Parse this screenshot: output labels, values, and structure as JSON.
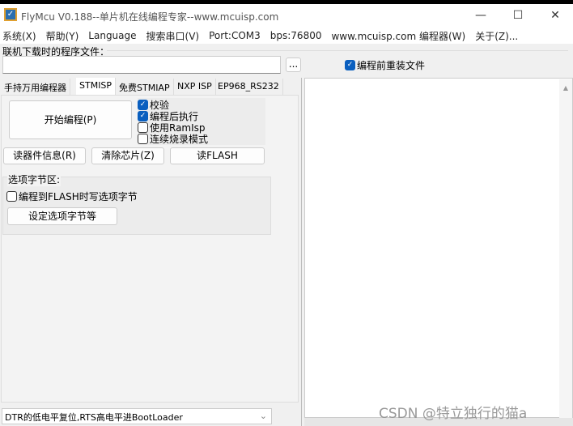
{
  "window": {
    "title": "FlyMcu V0.188--单片机在线编程专家--www.mcuisp.com",
    "minimize": "—",
    "maximize": "☐",
    "close": "✕"
  },
  "menu": [
    "系统(X)",
    "帮助(Y)",
    "Language",
    "搜索串口(V)",
    "Port:COM3",
    "bps:76800",
    "www.mcuisp.com 编程器(W)",
    "关于(Z)..."
  ],
  "file": {
    "label": "联机下载时的程序文件：",
    "value": "",
    "browse": "...",
    "reload_label": "编程前重装文件"
  },
  "tabs": [
    "手持万用编程器",
    "STMISP",
    "免费STMIAP",
    "NXP ISP",
    "EP968_RS232"
  ],
  "stmisp": {
    "start": "开始编程(P)",
    "options": [
      {
        "label": "校验",
        "checked": true
      },
      {
        "label": "编程后执行",
        "checked": true
      },
      {
        "label": "使用RamIsp",
        "checked": false
      },
      {
        "label": "连续烧录模式",
        "checked": false
      }
    ],
    "read_info": "读器件信息(R)",
    "erase": "清除芯片(Z)",
    "read_flash": "读FLASH",
    "option_group": "选项字节区:",
    "write_option": "编程到FLASH时写选项字节",
    "set_option": "设定选项字节等"
  },
  "reset_mode": "DTR的低电平复位,RTS高电平进BootLoader",
  "watermark": "CSDN @特立独行的猫a"
}
